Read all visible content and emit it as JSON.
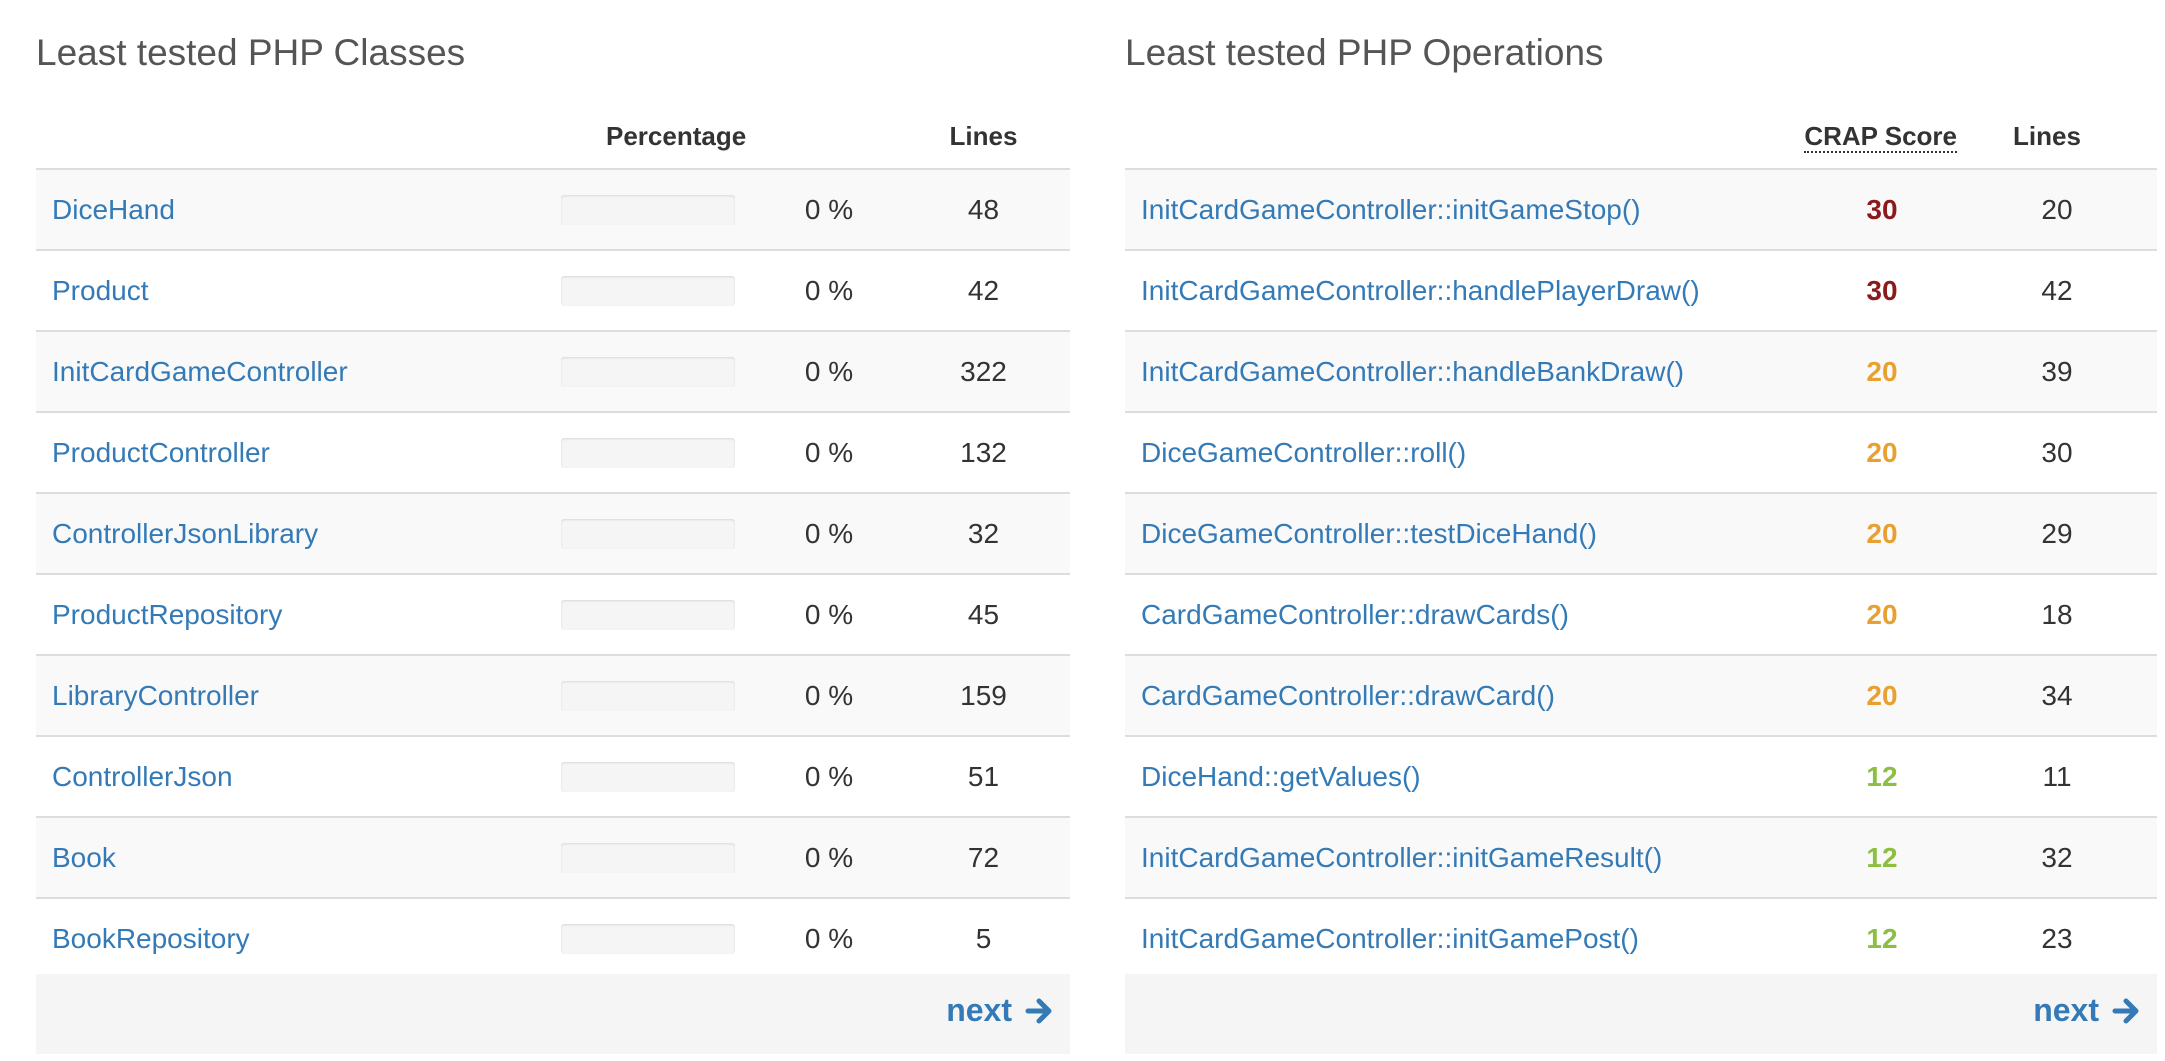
{
  "classes": {
    "title": "Least tested PHP Classes",
    "headers": {
      "name": "",
      "percentage": "Percentage",
      "lines": "Lines"
    },
    "rows": [
      {
        "name": "DiceHand",
        "coverage": 0,
        "percent_text": "0 %",
        "lines": "48"
      },
      {
        "name": "Product",
        "coverage": 0,
        "percent_text": "0 %",
        "lines": "42"
      },
      {
        "name": "InitCardGameController",
        "coverage": 0,
        "percent_text": "0 %",
        "lines": "322"
      },
      {
        "name": "ProductController",
        "coverage": 0,
        "percent_text": "0 %",
        "lines": "132"
      },
      {
        "name": "ControllerJsonLibrary",
        "coverage": 0,
        "percent_text": "0 %",
        "lines": "32"
      },
      {
        "name": "ProductRepository",
        "coverage": 0,
        "percent_text": "0 %",
        "lines": "45"
      },
      {
        "name": "LibraryController",
        "coverage": 0,
        "percent_text": "0 %",
        "lines": "159"
      },
      {
        "name": "ControllerJson",
        "coverage": 0,
        "percent_text": "0 %",
        "lines": "51"
      },
      {
        "name": "Book",
        "coverage": 0,
        "percent_text": "0 %",
        "lines": "72"
      },
      {
        "name": "BookRepository",
        "coverage": 0,
        "percent_text": "0 %",
        "lines": "5"
      }
    ],
    "next_label": "next"
  },
  "operations": {
    "title": "Least tested PHP Operations",
    "headers": {
      "name": "",
      "crap": "CRAP Score",
      "lines": "Lines"
    },
    "rows": [
      {
        "name": "InitCardGameController::initGameStop()",
        "crap": "30",
        "lines": "20",
        "crap_color": "#8b1a1a"
      },
      {
        "name": "InitCardGameController::handlePlayerDraw()",
        "crap": "30",
        "lines": "42",
        "crap_color": "#8b1a1a"
      },
      {
        "name": "InitCardGameController::handleBankDraw()",
        "crap": "20",
        "lines": "39",
        "crap_color": "#e8a030"
      },
      {
        "name": "DiceGameController::roll()",
        "crap": "20",
        "lines": "30",
        "crap_color": "#e8a030"
      },
      {
        "name": "DiceGameController::testDiceHand()",
        "crap": "20",
        "lines": "29",
        "crap_color": "#e8a030"
      },
      {
        "name": "CardGameController::drawCards()",
        "crap": "20",
        "lines": "18",
        "crap_color": "#e8a030"
      },
      {
        "name": "CardGameController::drawCard()",
        "crap": "20",
        "lines": "34",
        "crap_color": "#e8a030"
      },
      {
        "name": "DiceHand::getValues()",
        "crap": "12",
        "lines": "11",
        "crap_color": "#8cbf3f"
      },
      {
        "name": "InitCardGameController::initGameResult()",
        "crap": "12",
        "lines": "32",
        "crap_color": "#8cbf3f"
      },
      {
        "name": "InitCardGameController::initGamePost()",
        "crap": "12",
        "lines": "23",
        "crap_color": "#8cbf3f"
      }
    ],
    "next_label": "next"
  },
  "colors": {
    "link": "#337ab7",
    "bar_fill": "#d9534f",
    "stripe": "#f9f9f9"
  },
  "icons": {
    "next": "arrow-right-icon"
  }
}
